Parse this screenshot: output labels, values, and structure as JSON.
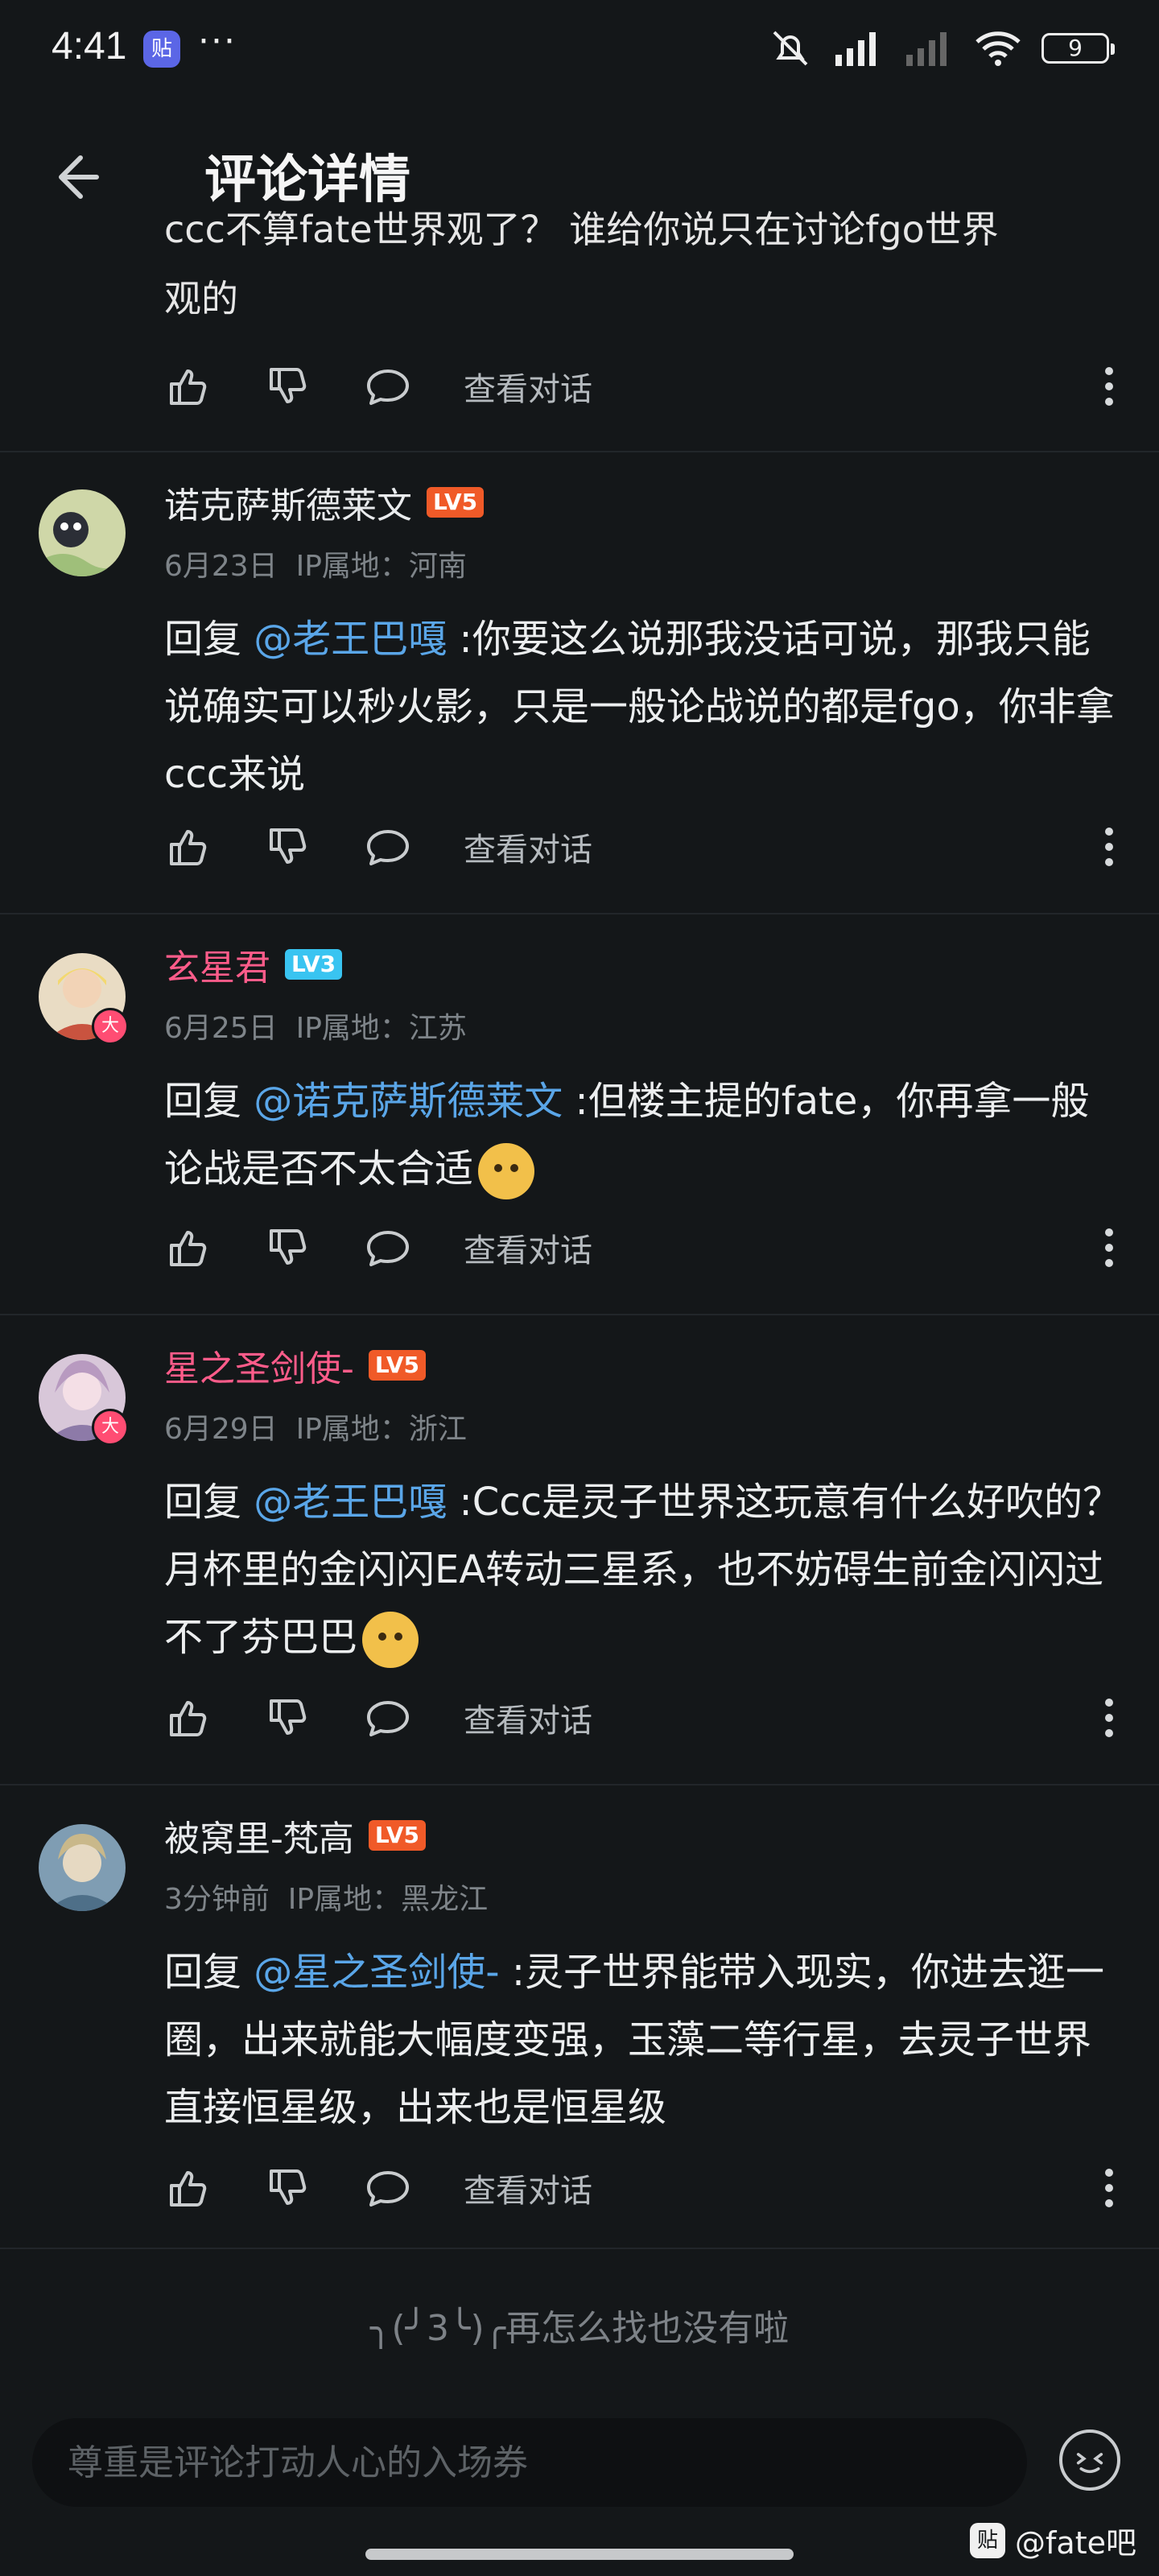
{
  "status_bar": {
    "time": "4:41",
    "app_badge": "贴",
    "more": "···",
    "battery": "9"
  },
  "header": {
    "title": "评论详情"
  },
  "partial": {
    "line1": "ccc不算fate世界观了？ 谁给你说只在讨论fgo世界",
    "line2": "观的"
  },
  "actions": {
    "view_conversation": "查看对话"
  },
  "comments": [
    {
      "username": "诺克萨斯德莱文",
      "level": "LV5",
      "date": "6月23日",
      "ip": "IP属地：河南",
      "reply_prefix": "回复 ",
      "mention": "@老王巴嘎",
      "text": " :你要这么说那我没话可说，那我只能说确实可以秒火影，只是一般论战说的都是fgo，你非拿ccc来说"
    },
    {
      "username": "玄星君",
      "level": "LV3",
      "badge": "大",
      "date": "6月25日",
      "ip": "IP属地：江苏",
      "reply_prefix": "回复 ",
      "mention": "@诺克萨斯德莱文",
      "text": " :但楼主提的fate，你再拿一般论战是否不太合适"
    },
    {
      "username": "星之圣剑使-",
      "level": "LV5",
      "badge": "大",
      "date": "6月29日",
      "ip": "IP属地：浙江",
      "reply_prefix": "回复 ",
      "mention": "@老王巴嘎",
      "text": " :Ccc是灵子世界这玩意有什么好吹的？月杯里的金闪闪EA转动三星系，也不妨碍生前金闪闪过不了芬巴巴"
    },
    {
      "username": "被窝里-梵高",
      "level": "LV5",
      "date": "3分钟前",
      "ip": "IP属地：黑龙江",
      "reply_prefix": "回复 ",
      "mention": "@星之圣剑使-",
      "text": " :灵子世界能带入现实，你进去逛一圈，出来就能大幅度变强，玉藻二等行星，去灵子世界直接恒星级，出来也是恒星级"
    }
  ],
  "end_text": "╮(╯3╰)╭再怎么找也没有啦",
  "input": {
    "placeholder": "尊重是评论打动人心的入场券"
  },
  "watermark": {
    "logo": "贴",
    "text": "@fate吧"
  }
}
